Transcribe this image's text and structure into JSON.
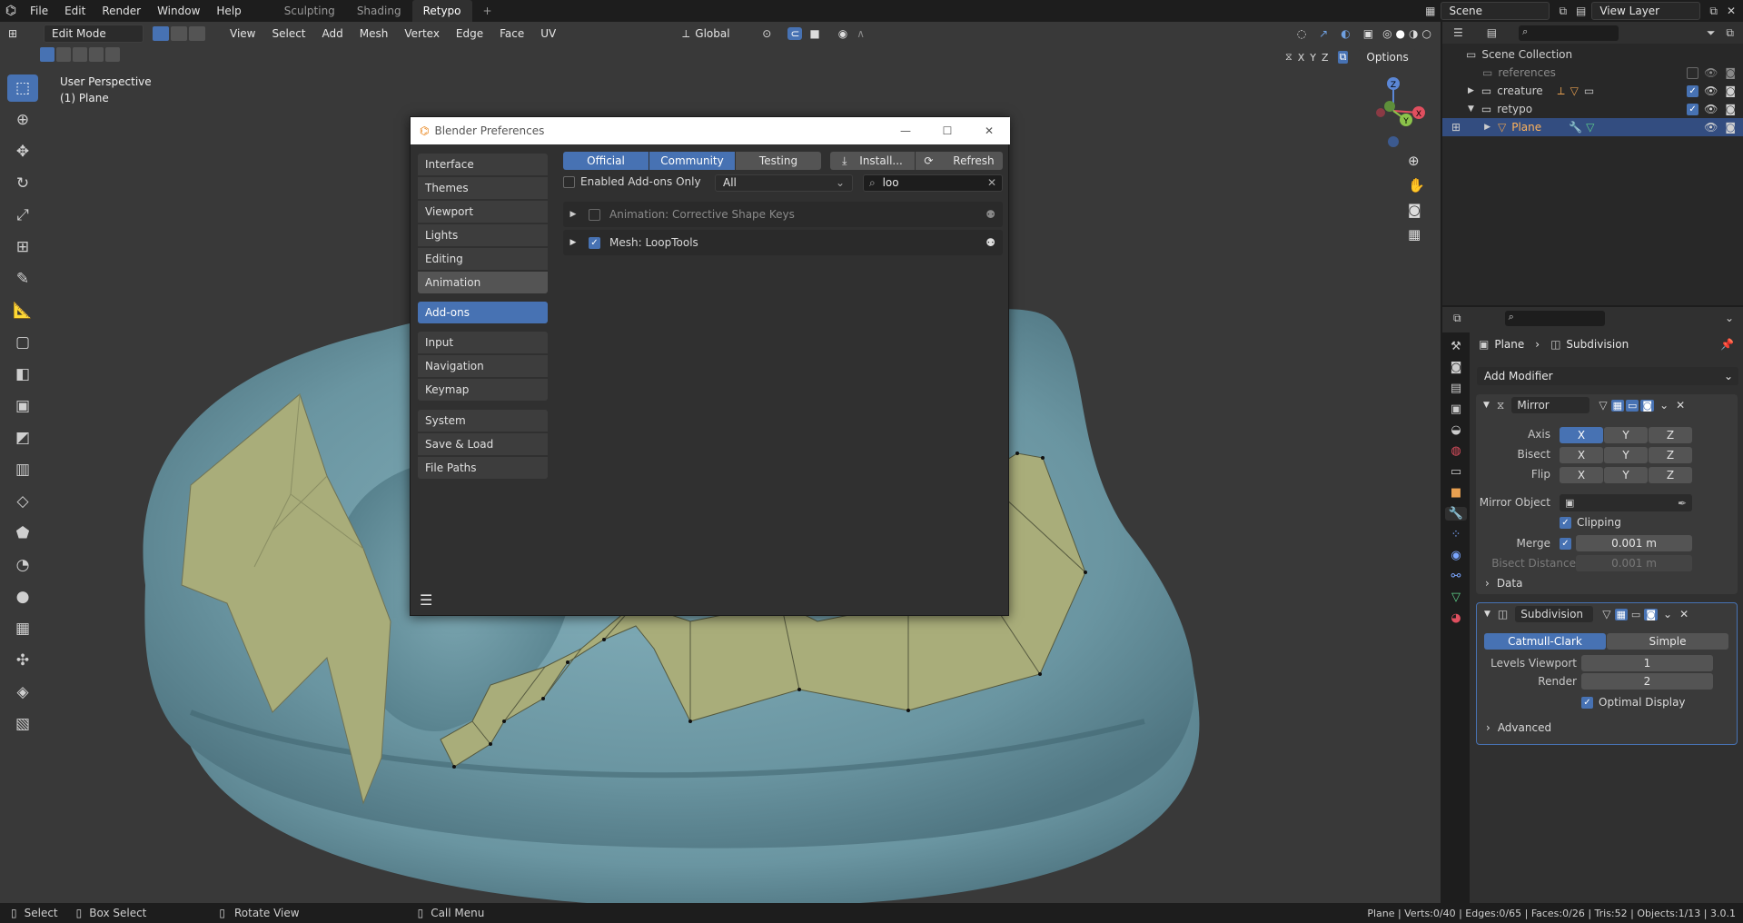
{
  "topbar": {
    "menus": [
      "File",
      "Edit",
      "Render",
      "Window",
      "Help"
    ],
    "workspaces": [
      "Sculpting",
      "Shading",
      "Retypo",
      "+"
    ],
    "active_workspace": "Retypo",
    "scene": "Scene",
    "view_layer": "View Layer"
  },
  "viewport": {
    "mode": "Edit Mode",
    "menus": [
      "View",
      "Select",
      "Add",
      "Mesh",
      "Vertex",
      "Edge",
      "Face",
      "UV"
    ],
    "transform_orientation": "Global",
    "axes": [
      "X",
      "Y",
      "Z"
    ],
    "options_label": "Options",
    "perspective": "User Perspective",
    "object": "(1) Plane"
  },
  "prefs": {
    "title": "Blender Preferences",
    "nav_group1": [
      "Interface",
      "Themes",
      "Viewport",
      "Lights",
      "Editing",
      "Animation"
    ],
    "nav_active": "Add-ons",
    "nav_group2": [
      "Input",
      "Navigation",
      "Keymap"
    ],
    "nav_group3": [
      "System",
      "Save & Load",
      "File Paths"
    ],
    "tabs": [
      "Official",
      "Community",
      "Testing"
    ],
    "install_label": "Install...",
    "refresh_label": "Refresh",
    "enabled_only_label": "Enabled Add-ons Only",
    "category": "All",
    "search_value": "loo",
    "addons": [
      {
        "name": "Animation: Corrective Shape Keys",
        "enabled": false
      },
      {
        "name": "Mesh: LoopTools",
        "enabled": true
      }
    ]
  },
  "outliner": {
    "title": "Scene Collection",
    "rows": [
      {
        "label": "references"
      },
      {
        "label": "creature"
      },
      {
        "label": "retypo"
      },
      {
        "label": "Plane"
      }
    ]
  },
  "properties": {
    "breadcrumb_object": "Plane",
    "breadcrumb_modifier": "Subdivision",
    "add_modifier": "Add Modifier",
    "mirror": {
      "name": "Mirror",
      "axis_label": "Axis",
      "bisect_label": "Bisect",
      "flip_label": "Flip",
      "axes": [
        "X",
        "Y",
        "Z"
      ],
      "mirror_object_label": "Mirror Object",
      "clipping_label": "Clipping",
      "merge_label": "Merge",
      "merge_value": "0.001 m",
      "bisect_distance_label": "Bisect Distance",
      "bisect_distance_value": "0.001 m",
      "data_label": "Data"
    },
    "subdivision": {
      "name": "Subdivision",
      "type_a": "Catmull-Clark",
      "type_b": "Simple",
      "levels_viewport_label": "Levels Viewport",
      "levels_viewport": "1",
      "render_label": "Render",
      "render": "2",
      "optimal_display_label": "Optimal Display",
      "advanced_label": "Advanced"
    }
  },
  "statusbar": {
    "select": "Select",
    "box_select": "Box Select",
    "rotate_view": "Rotate View",
    "call_menu": "Call Menu",
    "stats": "Plane | Verts:0/40 | Edges:0/65 | Faces:0/26 | Tris:52 | Objects:1/13 | 3.0.1"
  },
  "colors": {
    "accent": "#4772b3",
    "viewport_bg": "#393939",
    "mesh_body": "#6f9aa6",
    "retopo_face": "#a9ad7a"
  }
}
